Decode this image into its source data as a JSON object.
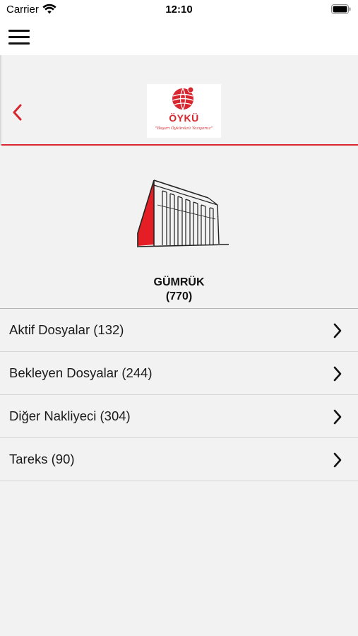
{
  "status_bar": {
    "carrier": "Carrier",
    "time": "12:10",
    "icons": [
      "wifi-icon",
      "battery-icon"
    ]
  },
  "nav": {
    "menu_icon": "hamburger-menu-icon"
  },
  "header": {
    "back_icon": "chevron-left-icon",
    "logo": {
      "name": "ÖYKÜ",
      "slogan": "\"Başarı Öykünüzü Yazıyoruz\""
    },
    "colors": {
      "accent": "#d7262e"
    }
  },
  "section": {
    "illustration": "customs-building-illustration",
    "title": "GÜMRÜK",
    "count": "(770)"
  },
  "list": {
    "items": [
      {
        "label": "Aktif Dosyalar (132)"
      },
      {
        "label": "Bekleyen Dosyalar (244)"
      },
      {
        "label": "Diğer Nakliyeci (304)"
      },
      {
        "label": "Tareks (90)"
      }
    ],
    "chevron_icon": "chevron-right-icon"
  }
}
